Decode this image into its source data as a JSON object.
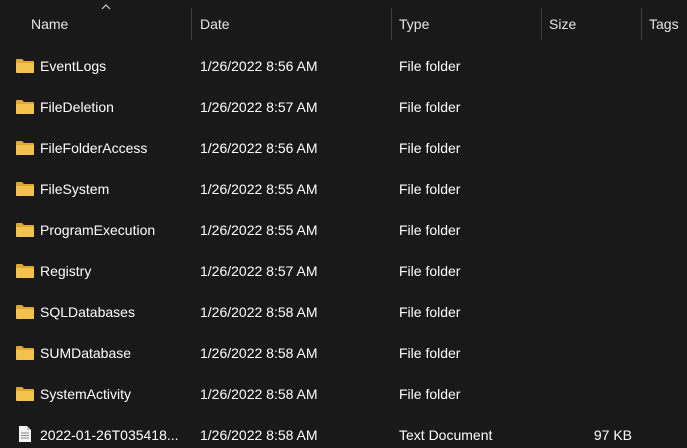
{
  "columns": {
    "name": "Name",
    "date": "Date",
    "type": "Type",
    "size": "Size",
    "tags": "Tags"
  },
  "sort": {
    "column": "name",
    "direction": "ascending",
    "icon": "chevron-up-icon"
  },
  "colors": {
    "background": "#191919",
    "text": "#ffffff",
    "folder": "#f2c14e",
    "separator": "#3d3d3d"
  },
  "files": [
    {
      "name": "EventLogs",
      "date": "1/26/2022 8:56 AM",
      "type": "File folder",
      "size": "",
      "icon": "folder-icon"
    },
    {
      "name": "FileDeletion",
      "date": "1/26/2022 8:57 AM",
      "type": "File folder",
      "size": "",
      "icon": "folder-icon"
    },
    {
      "name": "FileFolderAccess",
      "date": "1/26/2022 8:56 AM",
      "type": "File folder",
      "size": "",
      "icon": "folder-icon"
    },
    {
      "name": "FileSystem",
      "date": "1/26/2022 8:55 AM",
      "type": "File folder",
      "size": "",
      "icon": "folder-icon"
    },
    {
      "name": "ProgramExecution",
      "date": "1/26/2022 8:55 AM",
      "type": "File folder",
      "size": "",
      "icon": "folder-icon"
    },
    {
      "name": "Registry",
      "date": "1/26/2022 8:57 AM",
      "type": "File folder",
      "size": "",
      "icon": "folder-icon"
    },
    {
      "name": "SQLDatabases",
      "date": "1/26/2022 8:58 AM",
      "type": "File folder",
      "size": "",
      "icon": "folder-icon"
    },
    {
      "name": "SUMDatabase",
      "date": "1/26/2022 8:58 AM",
      "type": "File folder",
      "size": "",
      "icon": "folder-icon"
    },
    {
      "name": "SystemActivity",
      "date": "1/26/2022 8:58 AM",
      "type": "File folder",
      "size": "",
      "icon": "folder-icon"
    },
    {
      "name": "2022-01-26T035418...",
      "date": "1/26/2022 8:58 AM",
      "type": "Text Document",
      "size": "97 KB",
      "icon": "text-document-icon"
    }
  ]
}
